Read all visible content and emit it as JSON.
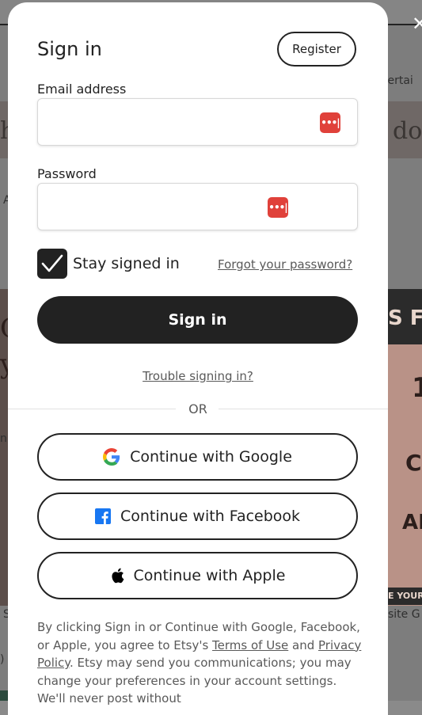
{
  "background": {
    "fragments": {
      "entertain": "tertai",
      "big_h": "h",
      "big_do": "do",
      "a": "A",
      "left_c": "C",
      "left_y": "y",
      "left_n": "n",
      "right_head": "S FL",
      "right_1": "1",
      "right_c": "C",
      "right_an": "AN",
      "right_your": "E YOUR",
      "site": "site G",
      "left_s": "S",
      "left_paren": ")"
    }
  },
  "modal": {
    "title": "Sign in",
    "register_label": "Register",
    "email_label": "Email address",
    "email_value": "",
    "password_label": "Password",
    "password_value": "",
    "password_manager_icon": "•••|",
    "stay_signed_in_label": "Stay signed in",
    "stay_signed_in_checked": true,
    "forgot_label": "Forgot your password?",
    "signin_label": "Sign in",
    "trouble_label": "Trouble signing in?",
    "or_label": "OR",
    "google_label": "Continue with Google",
    "facebook_label": "Continue with Facebook",
    "apple_label": "Continue with Apple",
    "legal": {
      "part1": "By clicking Sign in or Continue with Google, Facebook, or Apple, you agree to Etsy's ",
      "terms": "Terms of Use",
      "part2": " and ",
      "privacy": "Privacy Policy",
      "part3": ". Etsy may send you communications; you may change your preferences in your account settings. We'll never post without"
    }
  },
  "colors": {
    "primary": "#222222",
    "pw_manager_red": "#e0413a",
    "muted_text": "#595959",
    "facebook_blue": "#1877f2"
  }
}
